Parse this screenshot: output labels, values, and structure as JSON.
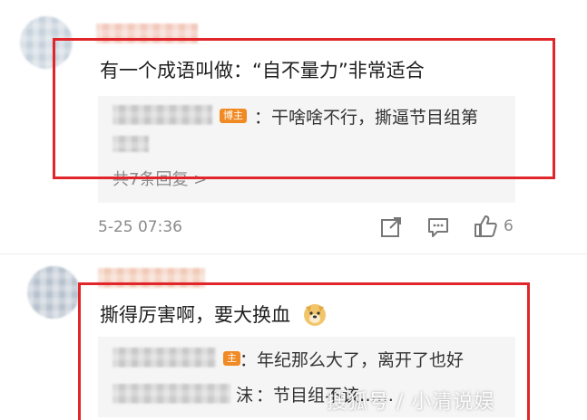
{
  "comment1": {
    "text": "有一个成语叫做：“自不量力”非常适合",
    "reply": {
      "badge": "博主",
      "text": "：干啥啥不行，撕逼节目组第",
      "more": "共7条回复 >"
    },
    "timestamp": "5-25 07:36",
    "like_count": "6"
  },
  "comment2": {
    "text": "撕得厉害啊，要大换血",
    "reply1": {
      "badge": "主",
      "text": "：年纪那么大了，离开了也好"
    },
    "reply2": {
      "prefix": "沫",
      "text": "：节目组不该……"
    }
  },
  "watermark": "搜狐号 / 小清说娱",
  "colors": {
    "highlight_frame": "#e0262b",
    "badge": "#f08a24",
    "reply_bg": "#f5f5f5",
    "meta_text": "#8a8a8a"
  }
}
